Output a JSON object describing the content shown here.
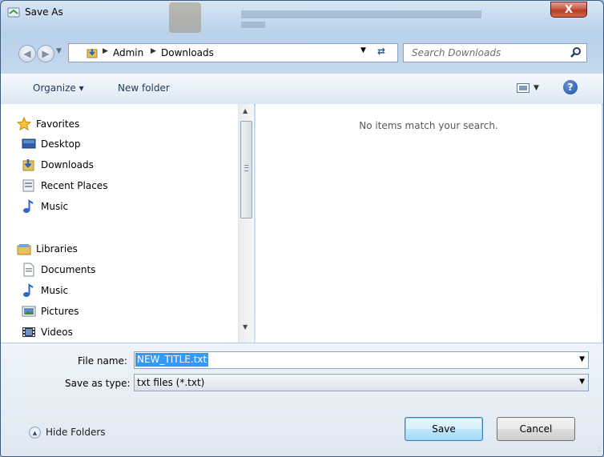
{
  "window": {
    "title": "Save As",
    "close_glyph": "X"
  },
  "address_bar": {
    "breadcrumbs": [
      "Admin",
      "Downloads"
    ],
    "folder_icon": "downloads-folder-icon"
  },
  "search": {
    "placeholder": "Search Downloads"
  },
  "toolbar": {
    "organize_label": "Organize ▾",
    "new_folder_label": "New folder"
  },
  "navigation": {
    "favorites": {
      "label": "Favorites",
      "items": [
        {
          "label": "Desktop",
          "icon": "desktop-icon"
        },
        {
          "label": "Downloads",
          "icon": "downloads-folder-icon"
        },
        {
          "label": "Recent Places",
          "icon": "recent-places-icon"
        },
        {
          "label": "Music",
          "icon": "music-icon"
        }
      ]
    },
    "libraries": {
      "label": "Libraries",
      "items": [
        {
          "label": "Documents",
          "icon": "documents-icon"
        },
        {
          "label": "Music",
          "icon": "music-icon"
        },
        {
          "label": "Pictures",
          "icon": "pictures-icon"
        },
        {
          "label": "Videos",
          "icon": "videos-icon"
        }
      ]
    }
  },
  "file_list": {
    "empty_message": "No items match your search."
  },
  "form": {
    "file_name_label": "File name:",
    "file_name_value": "NEW_TITLE.txt",
    "save_type_label": "Save as type:",
    "save_type_value": "txt files (*.txt)"
  },
  "footer": {
    "hide_folders_label": "Hide Folders",
    "save_label": "Save",
    "cancel_label": "Cancel"
  },
  "colors": {
    "selection": "#3399ff",
    "link_text": "#1e395b",
    "close_button": "#c95a45"
  }
}
